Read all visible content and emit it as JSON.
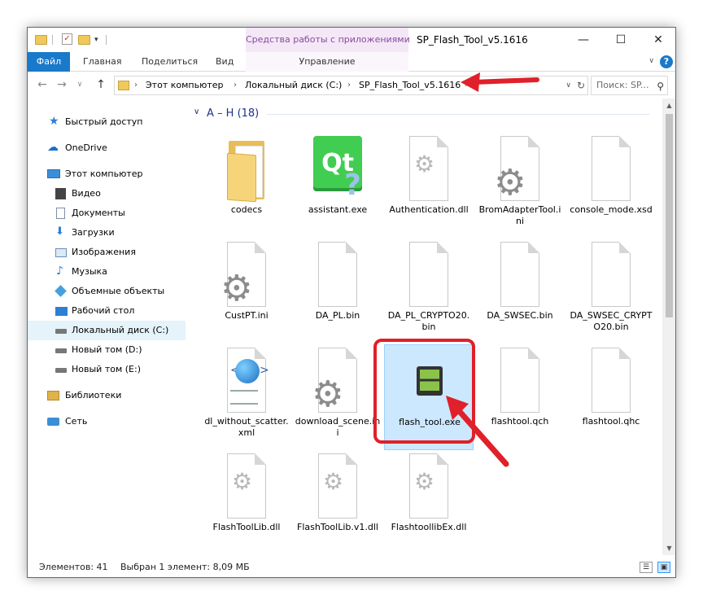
{
  "titlebar": {
    "context_tab": "Средства работы с приложениями",
    "title": "SP_Flash_Tool_v5.1616",
    "minimize": "—",
    "maximize": "☐",
    "close": "✕"
  },
  "ribbon": {
    "file": "Файл",
    "home": "Главная",
    "share": "Поделиться",
    "view": "Вид",
    "manage": "Управление",
    "expand": "∨",
    "help": "?"
  },
  "address": {
    "back": "←",
    "forward": "→",
    "recent": "∨",
    "up": "↑",
    "crumbs": [
      "Этот компьютер",
      "Локальный диск (C:)",
      "SP_Flash_Tool_v5.1616"
    ],
    "dropdown": "∨",
    "refresh": "↻",
    "search_placeholder": "Поиск: SP..."
  },
  "nav": {
    "items": [
      {
        "label": "Быстрый доступ",
        "icon": "star-icon",
        "color": "#2d7fd3"
      },
      {
        "label": "OneDrive",
        "icon": "cloud-icon",
        "color": "#1a6fc2"
      },
      {
        "label": "Этот компьютер",
        "icon": "monitor-icon",
        "color": "#3a8fd8"
      },
      {
        "label": "Видео",
        "icon": "film-icon",
        "color": "#555555"
      },
      {
        "label": "Документы",
        "icon": "document-icon",
        "color": "#7d8fa6"
      },
      {
        "label": "Загрузки",
        "icon": "download-icon",
        "color": "#2d7fd3"
      },
      {
        "label": "Изображения",
        "icon": "image-icon",
        "color": "#6b8fb5"
      },
      {
        "label": "Музыка",
        "icon": "music-icon",
        "color": "#2d7fd3"
      },
      {
        "label": "Объемные объекты",
        "icon": "cube-icon",
        "color": "#46a0dc"
      },
      {
        "label": "Рабочий стол",
        "icon": "desktop-icon",
        "color": "#2d7fd3"
      },
      {
        "label": "Локальный диск (C:)",
        "icon": "drive-icon",
        "color": "#666666"
      },
      {
        "label": "Новый том (D:)",
        "icon": "drive-icon",
        "color": "#666666"
      },
      {
        "label": "Новый том (E:)",
        "icon": "drive-icon",
        "color": "#666666"
      },
      {
        "label": "Библиотеки",
        "icon": "library-icon",
        "color": "#e0b24a"
      },
      {
        "label": "Сеть",
        "icon": "network-icon",
        "color": "#3a8fd8"
      }
    ]
  },
  "group": {
    "header": "A – H (18)",
    "chevron": "∨"
  },
  "files": [
    {
      "name": "codecs",
      "kind": "folder"
    },
    {
      "name": "assistant.exe",
      "kind": "qt"
    },
    {
      "name": "Authentication.dll",
      "kind": "dll"
    },
    {
      "name": "BromAdapterTool.ini",
      "kind": "ini"
    },
    {
      "name": "console_mode.xsd",
      "kind": "blank"
    },
    {
      "name": "CustPT.ini",
      "kind": "ini"
    },
    {
      "name": "DA_PL.bin",
      "kind": "blank"
    },
    {
      "name": "DA_PL_CRYPTO20.bin",
      "kind": "blank"
    },
    {
      "name": "DA_SWSEC.bin",
      "kind": "blank"
    },
    {
      "name": "DA_SWSEC_CRYPTO20.bin",
      "kind": "blank"
    },
    {
      "name": "dl_without_scatter.xml",
      "kind": "xml"
    },
    {
      "name": "download_scene.ini",
      "kind": "ini"
    },
    {
      "name": "flash_tool.exe",
      "kind": "app",
      "selected": true
    },
    {
      "name": "flashtool.qch",
      "kind": "blank"
    },
    {
      "name": "flashtool.qhc",
      "kind": "blank"
    },
    {
      "name": "FlashToolLib.dll",
      "kind": "dll"
    },
    {
      "name": "FlashToolLib.v1.dll",
      "kind": "dll"
    },
    {
      "name": "FlashtoollibEx.dll",
      "kind": "dll"
    }
  ],
  "status": {
    "items": "Элементов: 41",
    "selected": "Выбран 1 элемент: 8,09 МБ"
  },
  "colors": {
    "accent": "#1979ca",
    "annotation": "#e0202a",
    "selection": "#cce8ff"
  }
}
